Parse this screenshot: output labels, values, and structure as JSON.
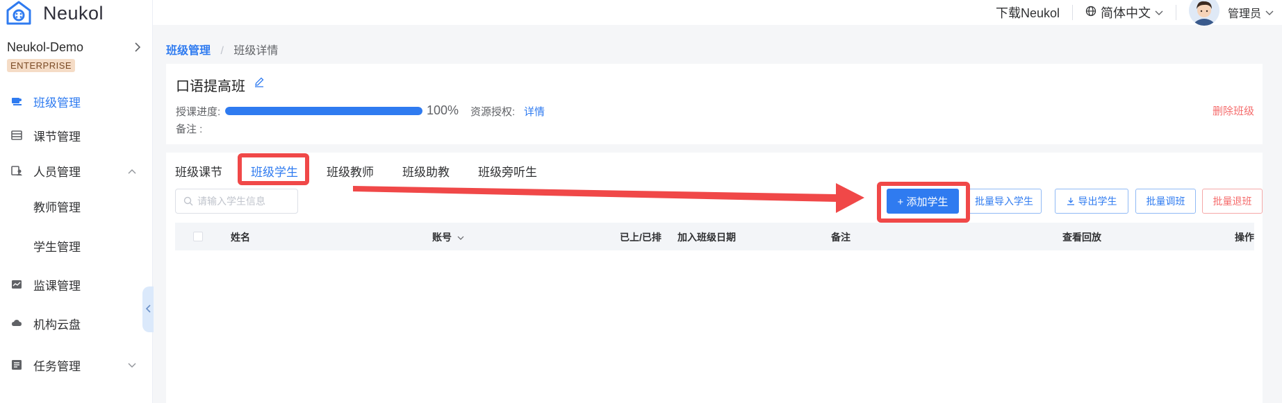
{
  "app": {
    "logo_text": "Neukol",
    "org_name": "Neukol-Demo",
    "org_badge": "ENTERPRISE"
  },
  "header": {
    "download_link": "下载Neukol",
    "language": "简体中文",
    "user_name": "管理员"
  },
  "sidebar": {
    "items": [
      {
        "label": "班级管理",
        "icon": "class-icon",
        "active": true
      },
      {
        "label": "课节管理",
        "icon": "list-icon"
      },
      {
        "label": "人员管理",
        "icon": "people-icon",
        "expanded": true
      },
      {
        "label": "教师管理",
        "sub": true
      },
      {
        "label": "学生管理",
        "sub": true
      },
      {
        "label": "监课管理",
        "icon": "monitor-icon"
      },
      {
        "label": "机构云盘",
        "icon": "cloud-icon"
      },
      {
        "label": "任务管理",
        "icon": "task-icon"
      }
    ]
  },
  "breadcrumb": {
    "parent": "班级管理",
    "separator": "/",
    "current": "班级详情"
  },
  "class_info": {
    "title": "口语提高班",
    "progress_label": "授课进度:",
    "progress_percent": "100%",
    "progress_value": 1.0,
    "resource_label": "资源授权:",
    "resource_link": "详情",
    "note_label": "备注 :",
    "delete_label": "删除班级"
  },
  "tabs": [
    {
      "label": "班级课节"
    },
    {
      "label": "班级学生",
      "active": true
    },
    {
      "label": "班级教师"
    },
    {
      "label": "班级助教"
    },
    {
      "label": "班级旁听生"
    }
  ],
  "toolbar": {
    "search_placeholder": "请输入学生信息",
    "add_student": "+ 添加学生",
    "batch_import": "批量导入学生",
    "export": "导出学生",
    "batch_transfer": "批量调班",
    "batch_withdraw": "批量退班"
  },
  "table": {
    "columns": [
      "姓名",
      "账号",
      "已上/已排",
      "加入班级日期",
      "备注",
      "查看回放",
      "操作"
    ]
  },
  "colors": {
    "primary": "#2f7bf0",
    "danger": "#f56c6c",
    "annotation_red": "#f04848"
  }
}
